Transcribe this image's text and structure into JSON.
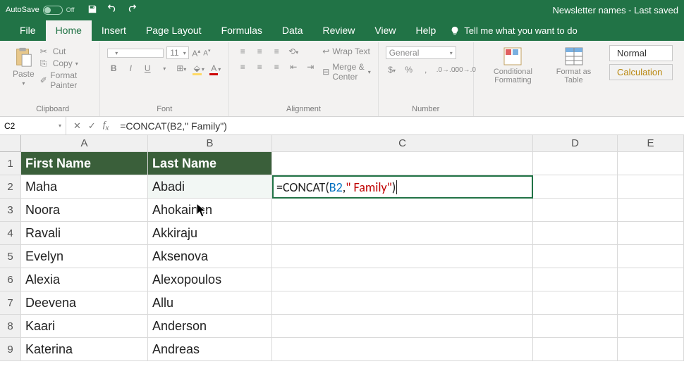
{
  "titlebar": {
    "autosave_label": "AutoSave",
    "autosave_state": "Off",
    "doc_title": "Newsletter names  -  Last saved "
  },
  "tabs": {
    "file": "File",
    "home": "Home",
    "insert": "Insert",
    "page_layout": "Page Layout",
    "formulas": "Formulas",
    "data": "Data",
    "review": "Review",
    "view": "View",
    "help": "Help",
    "tellme": "Tell me what you want to do"
  },
  "ribbon": {
    "clipboard": {
      "paste": "Paste",
      "cut": "Cut",
      "copy": "Copy",
      "painter": "Format Painter",
      "label": "Clipboard"
    },
    "font": {
      "size": "11",
      "bold": "B",
      "italic": "I",
      "underline": "U",
      "label": "Font"
    },
    "alignment": {
      "wrap": "Wrap Text",
      "merge": "Merge & Center",
      "label": "Alignment"
    },
    "number": {
      "format": "General",
      "label": "Number"
    },
    "styles": {
      "cond": "Conditional Formatting",
      "fmt": "Format as Table",
      "normal": "Normal",
      "calc": "Calculation"
    }
  },
  "formula_bar": {
    "cell_ref": "C2",
    "formula": "=CONCAT(B2,\" Family\")"
  },
  "columns": [
    "A",
    "B",
    "C",
    "D",
    "E"
  ],
  "headers": {
    "A": "First Name",
    "B": "Last Name"
  },
  "rows": [
    {
      "n": "1"
    },
    {
      "n": "2",
      "A": "Maha",
      "B": "Abadi"
    },
    {
      "n": "3",
      "A": "Noora",
      "B": "Ahokainen"
    },
    {
      "n": "4",
      "A": "Ravali",
      "B": "Akkiraju"
    },
    {
      "n": "5",
      "A": "Evelyn",
      "B": "Aksenova"
    },
    {
      "n": "6",
      "A": "Alexia",
      "B": "Alexopoulos"
    },
    {
      "n": "7",
      "A": "Deevena",
      "B": "Allu"
    },
    {
      "n": "8",
      "A": "Kaari",
      "B": "Anderson"
    },
    {
      "n": "9",
      "A": "Katerina",
      "B": "Andreas"
    }
  ],
  "editing_cell": {
    "prefix": "=CONCAT(",
    "ref": "B2",
    "mid": ",",
    "str": "\" Family\"",
    "suffix": ")"
  }
}
